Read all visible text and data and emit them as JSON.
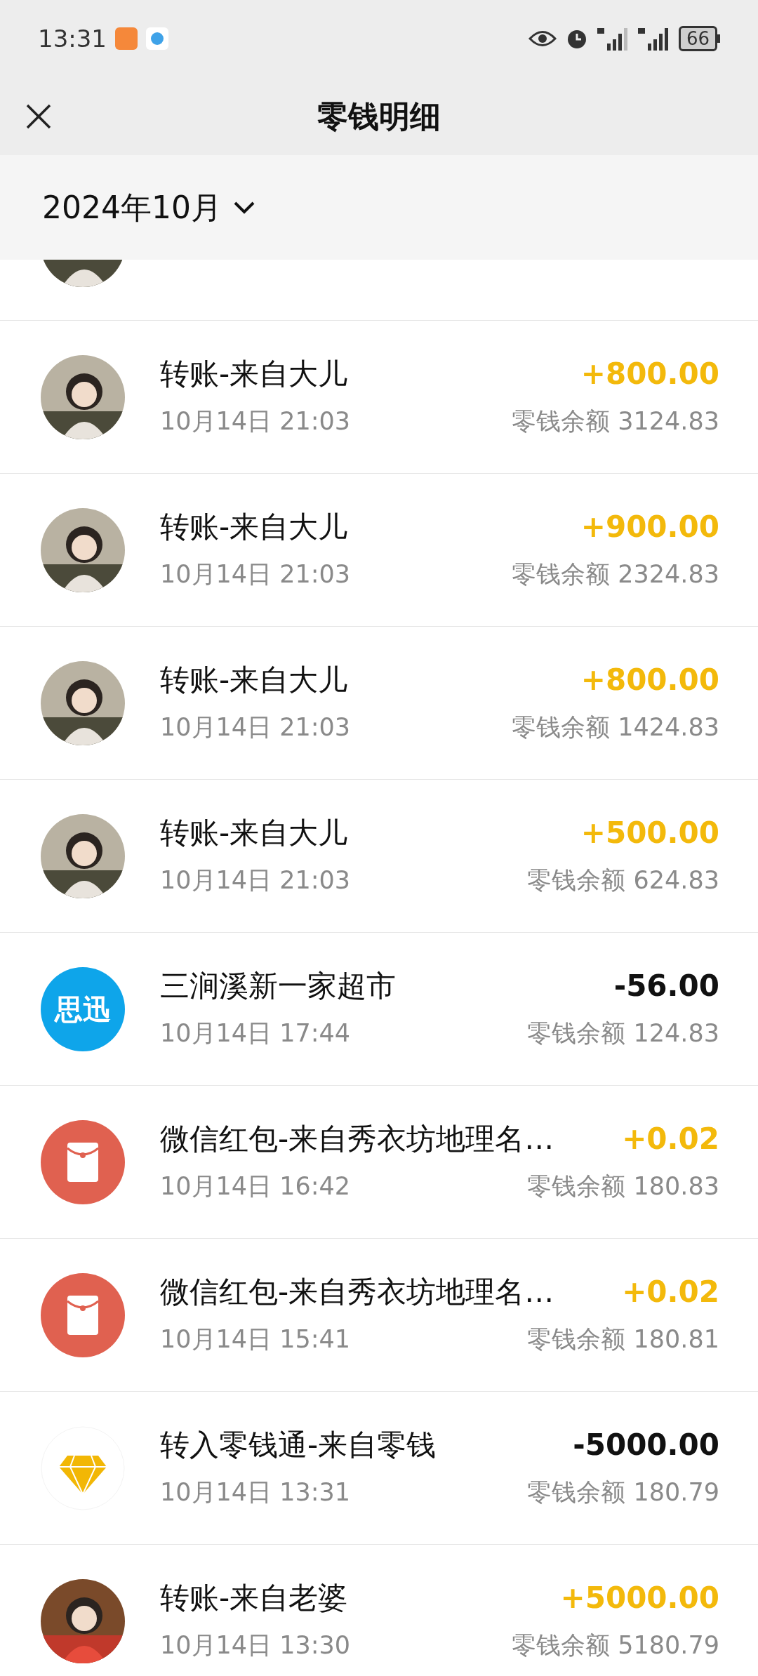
{
  "status_bar": {
    "time": "13:31",
    "battery": "66"
  },
  "header": {
    "title": "零钱明细"
  },
  "month_picker": {
    "label": "2024年10月"
  },
  "transactions": [
    {
      "kind": "avatar",
      "partial": true
    },
    {
      "kind": "avatar",
      "title": "转账-来自大儿",
      "amount": "+800.00",
      "income": true,
      "time": "10月14日 21:03",
      "balance": "零钱余额 3124.83"
    },
    {
      "kind": "avatar",
      "title": "转账-来自大儿",
      "amount": "+900.00",
      "income": true,
      "time": "10月14日 21:03",
      "balance": "零钱余额 2324.83"
    },
    {
      "kind": "avatar",
      "title": "转账-来自大儿",
      "amount": "+800.00",
      "income": true,
      "time": "10月14日 21:03",
      "balance": "零钱余额 1424.83"
    },
    {
      "kind": "avatar",
      "title": "转账-来自大儿",
      "amount": "+500.00",
      "income": true,
      "time": "10月14日 21:03",
      "balance": "零钱余额 624.83"
    },
    {
      "kind": "logo",
      "logo_text": "思迅",
      "title": "三涧溪新一家超市",
      "amount": "-56.00",
      "income": false,
      "time": "10月14日 17:44",
      "balance": "零钱余额 124.83"
    },
    {
      "kind": "red_packet",
      "title": "微信红包-来自秀衣坊地理名…",
      "amount": "+0.02",
      "income": true,
      "time": "10月14日 16:42",
      "balance": "零钱余额 180.83"
    },
    {
      "kind": "red_packet",
      "title": "微信红包-来自秀衣坊地理名…",
      "amount": "+0.02",
      "income": true,
      "time": "10月14日 15:41",
      "balance": "零钱余额 180.81"
    },
    {
      "kind": "diamond",
      "title": "转入零钱通-来自零钱",
      "amount": "-5000.00",
      "income": false,
      "time": "10月14日 13:31",
      "balance": "零钱余额 180.79"
    },
    {
      "kind": "avatar2",
      "title": "转账-来自老婆",
      "amount": "+5000.00",
      "income": true,
      "time": "10月14日 13:30",
      "balance": "零钱余额 5180.79"
    }
  ]
}
